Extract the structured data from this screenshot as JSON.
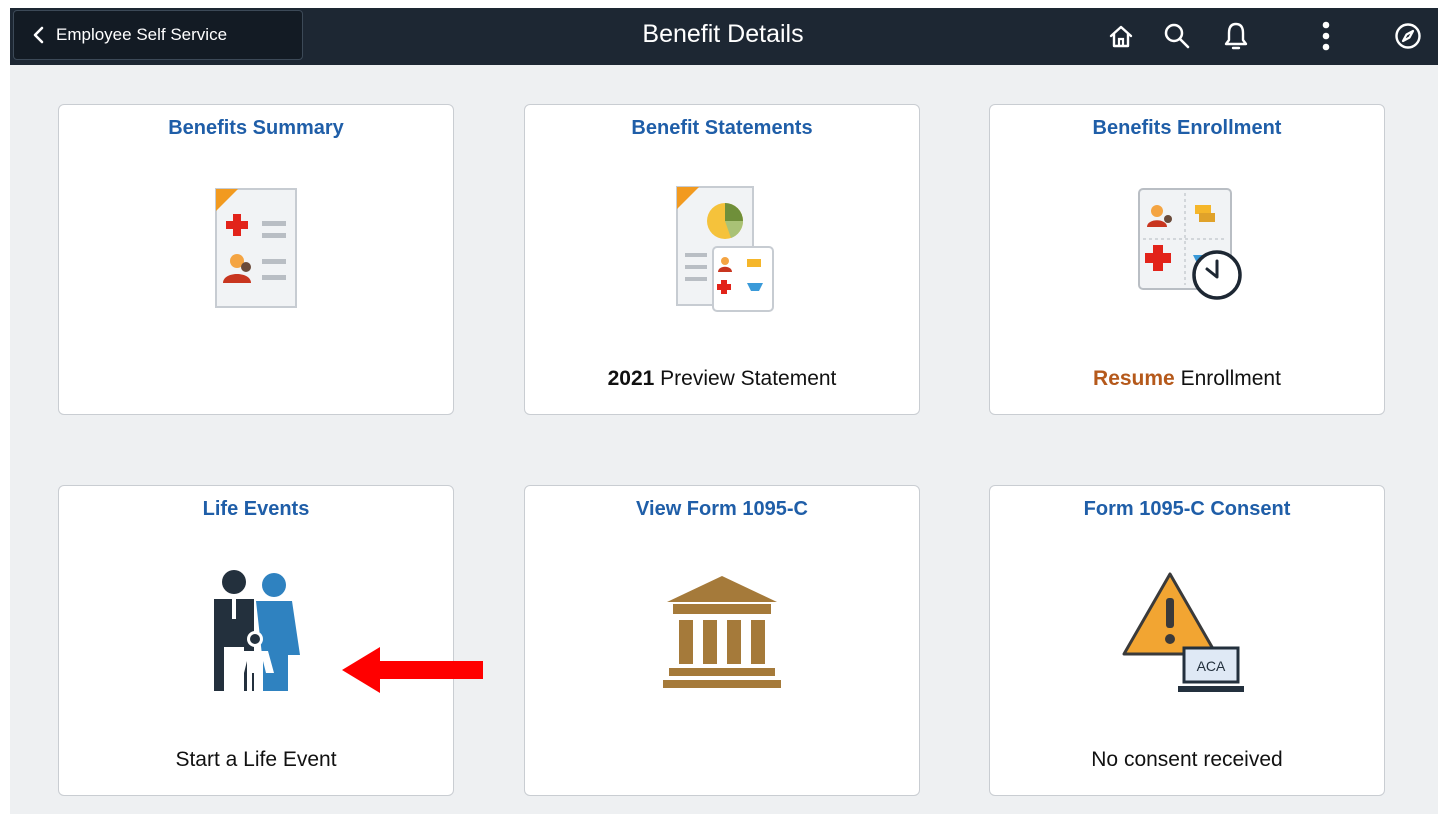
{
  "header": {
    "back_label": "Employee Self Service",
    "title": "Benefit Details",
    "icons": [
      "home-icon",
      "search-icon",
      "notifications-icon",
      "actions-menu-icon",
      "navbar-compass-icon"
    ]
  },
  "tiles": [
    {
      "title": "Benefits Summary",
      "icon": "benefits-summary-document-icon",
      "status_strong": "",
      "status_text": ""
    },
    {
      "title": "Benefit Statements",
      "icon": "benefit-statements-icon",
      "status_strong": "2021",
      "status_text": " Preview Statement"
    },
    {
      "title": "Benefits Enrollment",
      "icon": "benefits-enrollment-clock-icon",
      "status_strong": "Resume",
      "status_text": " Enrollment"
    },
    {
      "title": "Life Events",
      "icon": "family-icon",
      "status_strong": "",
      "status_text": "Start a Life Event"
    },
    {
      "title": "View Form 1095-C",
      "icon": "government-building-icon",
      "status_strong": "",
      "status_text": ""
    },
    {
      "title": "Form 1095-C Consent",
      "icon": "warning-laptop-icon",
      "icon_label": "ACA",
      "status_strong": "",
      "status_text": "No consent received"
    }
  ],
  "annotation": {
    "arrow_color": "#ff0000",
    "points_to": "Life Events tile"
  },
  "colors": {
    "topbar": "#1d2733",
    "tile_title": "#1f5ea8",
    "resume_accent": "#b5591b",
    "page_bg": "#eef0f2"
  }
}
